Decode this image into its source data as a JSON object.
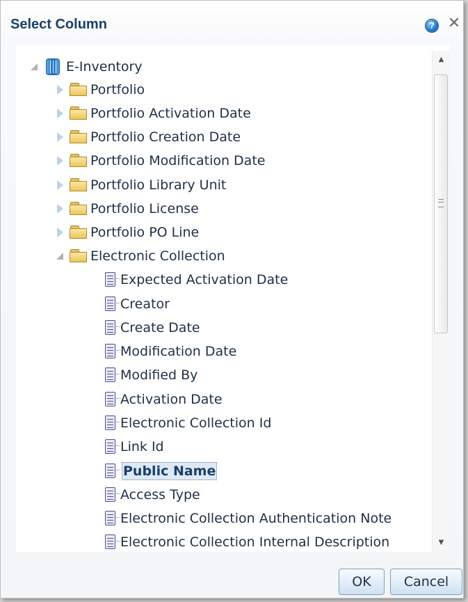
{
  "dialog": {
    "title": "Select Column",
    "help_glyph": "?",
    "close_glyph": "✕"
  },
  "tree": {
    "root": {
      "label": "E-Inventory",
      "icon": "subject-area-icon",
      "expanded": true
    },
    "folders": [
      {
        "label": "Portfolio",
        "expanded": false
      },
      {
        "label": "Portfolio Activation Date",
        "expanded": false
      },
      {
        "label": "Portfolio Creation Date",
        "expanded": false
      },
      {
        "label": "Portfolio Modification Date",
        "expanded": false
      },
      {
        "label": "Portfolio Library Unit",
        "expanded": false
      },
      {
        "label": "Portfolio License",
        "expanded": false
      },
      {
        "label": "Portfolio PO Line",
        "expanded": false
      },
      {
        "label": "Electronic Collection",
        "expanded": true
      }
    ],
    "columns": [
      {
        "label": "Expected Activation Date"
      },
      {
        "label": "Creator"
      },
      {
        "label": "Create Date"
      },
      {
        "label": "Modification Date"
      },
      {
        "label": "Modified By"
      },
      {
        "label": "Activation Date"
      },
      {
        "label": "Electronic Collection Id"
      },
      {
        "label": "Link Id"
      },
      {
        "label": "Public Name",
        "selected": true
      },
      {
        "label": "Access Type"
      },
      {
        "label": "Electronic Collection Authentication Note"
      },
      {
        "label": "Electronic Collection Internal Description"
      }
    ]
  },
  "buttons": {
    "ok": "OK",
    "cancel": "Cancel"
  },
  "colors": {
    "title": "#1a3f69",
    "selection_bg": "#dfe9f5",
    "button_border": "#7f9fc2"
  }
}
